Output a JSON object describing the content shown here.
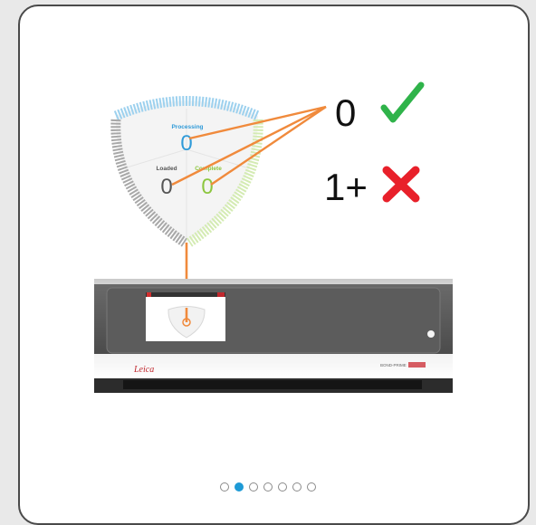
{
  "gauge": {
    "processing_label": "Processing",
    "processing_value": "0",
    "loaded_label": "Loaded",
    "loaded_value": "0",
    "complete_label": "Complete",
    "complete_value": "0"
  },
  "legend": {
    "ok_count": "0",
    "ok_icon": "check-icon",
    "error_count": "1+",
    "error_icon": "cross-icon"
  },
  "instrument": {
    "brand": "Leica",
    "model": "BOND-PRIME"
  },
  "pagination": {
    "total": 7,
    "active_index": 1
  },
  "colors": {
    "processing": "#2f9ad8",
    "loaded": "#555555",
    "complete": "#8cc63f",
    "connector": "#f08a3c",
    "check": "#2fb34a",
    "cross": "#e8202a",
    "active_dot": "#1e9ad6"
  }
}
